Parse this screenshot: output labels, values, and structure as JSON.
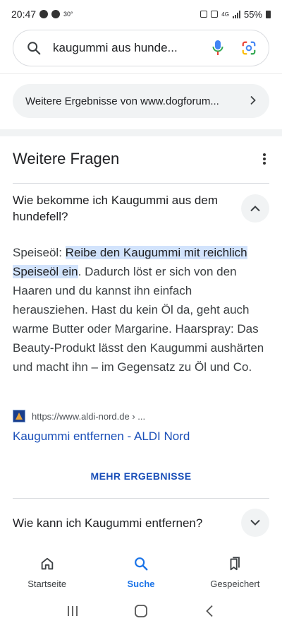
{
  "status_bar": {
    "time": "20:47",
    "temperature": "30°",
    "network": "4G",
    "battery": "55%"
  },
  "search": {
    "query": "kaugummi aus hunde...",
    "icon": "search-icon"
  },
  "more_results_chip": {
    "label": "Weitere Ergebnisse von www.dogforum..."
  },
  "section": {
    "title": "Weitere Fragen"
  },
  "question1": {
    "text": "Wie bekomme ich Kaugummi aus dem hundefell?",
    "expanded": true,
    "answer_prefix": "Speiseöl: ",
    "answer_highlight_1": "Reibe den Kaugummi mit reichlich",
    "answer_highlight_2": "Speiseöl ein",
    "answer_rest": ". Dadurch löst er sich von den Haaren und du kannst ihn einfach herausziehen. Hast du kein Öl da, geht auch warme Butter oder Margarine. Haarspray: Das Beauty-Produkt lässt den Kaugummi aushärten und macht ihn – im Gegensatz zu Öl und Co.",
    "source_url": "https://www.aldi-nord.de › ...",
    "source_title": "Kaugummi entfernen - ALDI Nord"
  },
  "more_button": {
    "label": "MEHR ERGEBNISSE"
  },
  "question2": {
    "text": "Wie kann ich Kaugummi entfernen?",
    "expanded": false
  },
  "bottom_nav": {
    "items": [
      {
        "label": "Startseite",
        "icon": "home-icon",
        "active": false
      },
      {
        "label": "Suche",
        "icon": "search-icon",
        "active": true
      },
      {
        "label": "Gespeichert",
        "icon": "bookmarks-icon",
        "active": false
      }
    ]
  },
  "colors": {
    "accent": "#1a73e8",
    "link": "#1a4fb8",
    "highlight": "#d2e3fc",
    "chip_bg": "#f1f3f4"
  }
}
